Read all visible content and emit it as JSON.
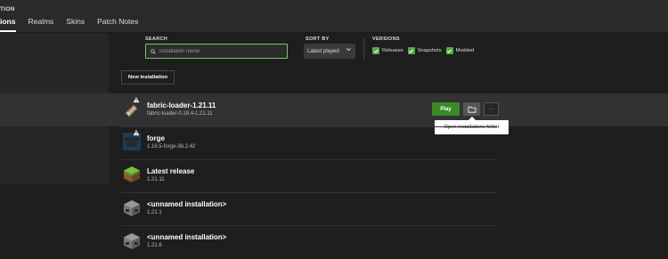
{
  "header": {
    "game_title": "TION",
    "tabs": [
      {
        "label": "ions"
      },
      {
        "label": "Realms"
      },
      {
        "label": "Skins"
      },
      {
        "label": "Patch Notes"
      }
    ]
  },
  "filters": {
    "search_label": "SEARCH",
    "search_placeholder": "installation name",
    "sort_label": "SORT BY",
    "sort_value": "Latest played",
    "versions_label": "VERSIONS",
    "checkboxes": [
      {
        "label": "Releases",
        "checked": true
      },
      {
        "label": "Snapshots",
        "checked": true
      },
      {
        "label": "Modded",
        "checked": true
      }
    ]
  },
  "new_installation_label": "New installation",
  "installations": [
    {
      "name": "fabric-loader-1.21.11",
      "version": "fabric-loader-0.18.4-1.21.11",
      "icon": "fabric-icon",
      "warning": true
    },
    {
      "name": "forge",
      "version": "1.16.5-forge-36.2.42",
      "icon": "forge-anvil-icon",
      "warning": true
    },
    {
      "name": "Latest release",
      "version": "1.21.11",
      "icon": "grass-block-icon",
      "warning": false
    },
    {
      "name": "<unnamed installation>",
      "version": "1.21.1",
      "icon": "furnace-icon",
      "warning": false
    },
    {
      "name": "<unnamed installation>",
      "version": "1.21.6",
      "icon": "furnace-icon",
      "warning": false
    }
  ],
  "row_actions": {
    "play_label": "Play",
    "more_label": "···",
    "tooltip": "Open installations folder"
  },
  "colors": {
    "accent_green": "#3a8a24",
    "search_border": "#6ccf5e",
    "checkbox_green": "#4fae3e"
  }
}
